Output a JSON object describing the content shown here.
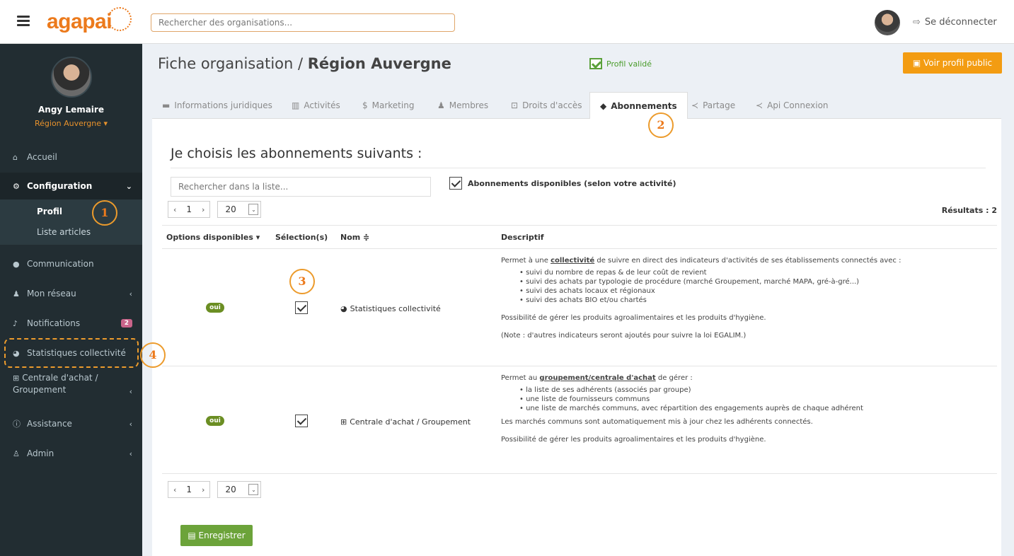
{
  "header": {
    "logo": "agapai",
    "search_placeholder": "Rechercher des organisations...",
    "logout": "Se déconnecter"
  },
  "sidebar": {
    "user_name": "Angy Lemaire",
    "user_org": "Région Auvergne ▾",
    "items": [
      {
        "label": "Accueil",
        "icon": "home-icon"
      },
      {
        "label": "Configuration",
        "icon": "cogs-icon"
      },
      {
        "label": "Communication",
        "icon": "chat-icon"
      },
      {
        "label": "Mon réseau",
        "icon": "users-icon"
      },
      {
        "label": "Notifications",
        "icon": "bell-icon",
        "badge": "2"
      },
      {
        "label": "Statistiques collectivité",
        "icon": "pie-chart-icon"
      },
      {
        "label": "Centrale d'achat / Groupement",
        "icon": "basket-icon"
      },
      {
        "label": "Assistance",
        "icon": "info-icon"
      },
      {
        "label": "Admin",
        "icon": "user-plus-icon"
      }
    ],
    "config_sub": [
      "Profil",
      "Liste articles"
    ]
  },
  "callouts": [
    "1",
    "2",
    "3",
    "4"
  ],
  "page": {
    "title_prefix": "Fiche organisation / ",
    "title_bold": "Région Auvergne",
    "validated": "Profil validé",
    "public_button": "Voir profil public"
  },
  "tabs": [
    {
      "label": "Informations juridiques",
      "icon": "folder-icon"
    },
    {
      "label": "Activités",
      "icon": "bar-chart-icon"
    },
    {
      "label": "Marketing",
      "icon": "dollar-icon"
    },
    {
      "label": "Membres",
      "icon": "users-icon"
    },
    {
      "label": "Droits d'accès",
      "icon": "lock-icon"
    },
    {
      "label": "Abonnements",
      "icon": "tag-icon",
      "active": true
    },
    {
      "label": "Partage",
      "icon": "share-icon"
    },
    {
      "label": "Api Connexion",
      "icon": "share-icon"
    }
  ],
  "panel": {
    "section_title": "Je choisis les abonnements suivants :",
    "list_search_placeholder": "Rechercher dans la liste...",
    "available_label": "Abonnements disponibles (selon votre activité)",
    "page": "1",
    "page_size": "20",
    "results": "Résultats : 2",
    "columns": [
      "Options disponibles ▾",
      "Sélection(s)",
      "Nom ≑",
      "Descriptif"
    ],
    "save_button": "Enregistrer"
  },
  "rows": [
    {
      "option": "oui",
      "name": "Statistiques collectivité",
      "desc_intro_a": "Permet à une ",
      "desc_kw": "collectivité",
      "desc_intro_b": " de suivre en direct des indicateurs d'activités de ses établissements connectés avec :",
      "bullets": [
        "suivi du nombre de repas & de leur coût de revient",
        "suivi des achats par typologie de procédure (marché Groupement, marché MAPA, gré-à-gré...)",
        "suivi des achats locaux et régionaux",
        "suivi des achats BIO et/ou chartés"
      ],
      "extra": [
        "Possibilité de gérer les produits agroalimentaires et les produits d'hygiène.",
        "(Note : d'autres indicateurs seront ajoutés pour suivre la loi EGALIM.)"
      ]
    },
    {
      "option": "oui",
      "name": "Centrale d'achat / Groupement",
      "desc_intro_a": "Permet au ",
      "desc_kw": "groupement/centrale d'achat",
      "desc_intro_b": " de gérer :",
      "bullets": [
        "la liste de ses adhérents (associés par groupe)",
        "une liste de fournisseurs communs",
        "une liste de marchés communs, avec répartition des engagements auprès de chaque adhérent"
      ],
      "extra": [
        "Les marchés communs sont automatiquement mis à jour chez les adhérents connectés.",
        "Possibilité de gérer les produits agroalimentaires et les produits d'hygiène."
      ]
    }
  ]
}
